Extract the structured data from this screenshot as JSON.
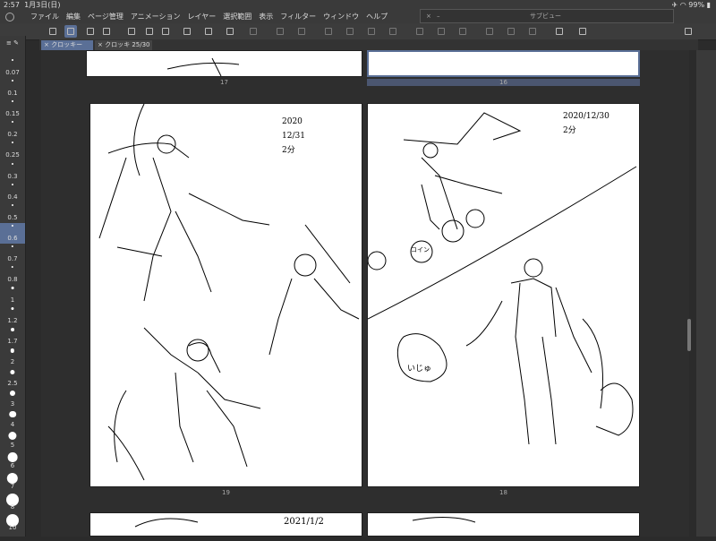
{
  "status": {
    "time": "2:57",
    "date": "1月3日(日)",
    "battery": "99%"
  },
  "menu": {
    "items": [
      "ファイル",
      "編集",
      "ページ管理",
      "アニメーション",
      "レイヤー",
      "選択範囲",
      "表示",
      "フィルター",
      "ウィンドウ",
      "ヘルプ"
    ]
  },
  "subview": {
    "title": "サブビュー",
    "close": "×",
    "min": "–"
  },
  "tabs": [
    {
      "label": "クロッキー"
    },
    {
      "label": "クロッキ 25/30"
    }
  ],
  "brush_sizes": [
    "0.07",
    "0.1",
    "0.15",
    "0.2",
    "0.25",
    "0.3",
    "0.4",
    "0.5",
    "0.6",
    "0.7",
    "0.8",
    "1",
    "1.2",
    "1.7",
    "2",
    "2.5",
    "3",
    "4",
    "5",
    "6",
    "7",
    "8",
    "10"
  ],
  "selected_brush": "0.6",
  "pages": [
    {
      "id": "17",
      "label": "17"
    },
    {
      "id": "16",
      "label": "16"
    },
    {
      "id": "19",
      "label": "19",
      "note": "2020\n12/31\n2分"
    },
    {
      "id": "18",
      "label": "18",
      "note": "2020/12/30\n2分"
    },
    {
      "id": "next",
      "label": "",
      "note": "2021/1/2"
    }
  ],
  "annotations": {
    "coin": "コイン",
    "sound": "いじゅ"
  },
  "icons": [
    "menu-icon",
    "pen-tool-icon",
    "chevrons-icon",
    "eraser-icon",
    "new-file-icon",
    "chevrons-icon",
    "open-folder-icon",
    "save-icon",
    "export-icon",
    "import-icon",
    "print-icon",
    "undo-icon",
    "redo-icon",
    "lasso-icon",
    "fill-icon",
    "move-icon",
    "transform-icon",
    "gradient-icon",
    "shape-icon",
    "ruler-icon",
    "pen-alt-icon",
    "brush-icon",
    "rotate-icon",
    "help-icon"
  ],
  "colors": {
    "accent": "#5a6f96",
    "bg": "#2b2b2b",
    "panel": "#3a3a3a"
  }
}
